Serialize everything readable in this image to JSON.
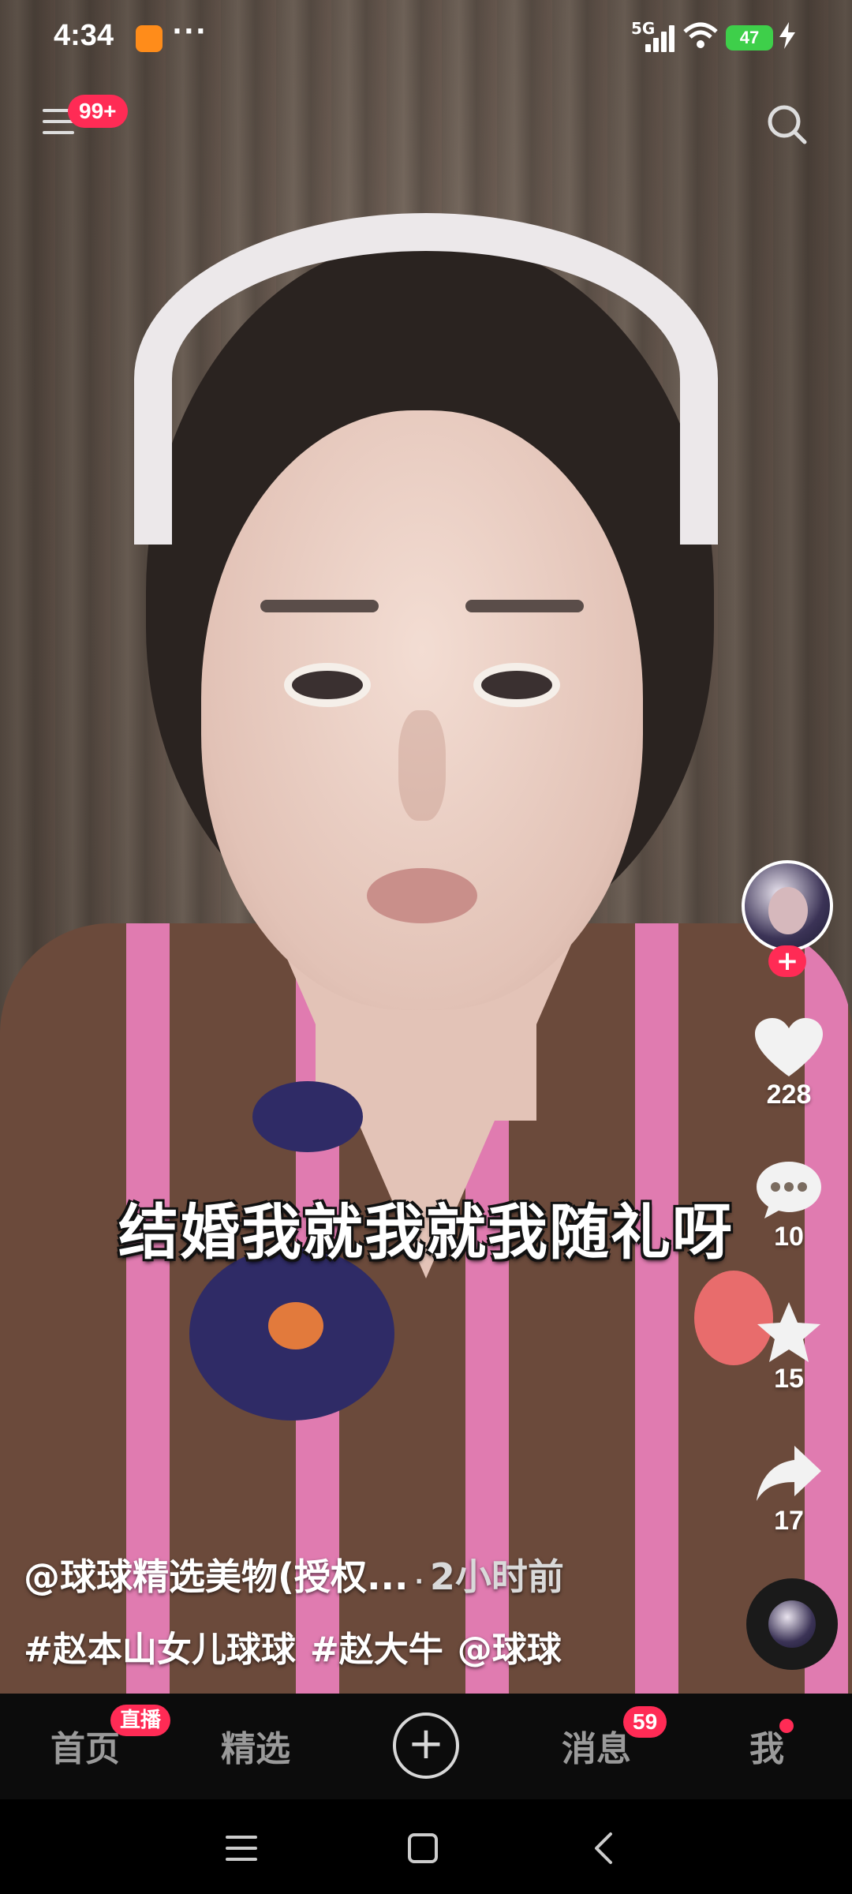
{
  "status_bar": {
    "time": "4:34",
    "network": "5G",
    "battery": "47",
    "more_dots": "···"
  },
  "top": {
    "notification_badge": "99+"
  },
  "subtitle": "结婚我就我就我随礼呀",
  "actions": {
    "likes": "228",
    "comments": "10",
    "favorites": "15",
    "shares": "17",
    "follow_symbol": "+"
  },
  "caption": {
    "author": "@球球精选美物(授权...",
    "separator": "·",
    "time_ago": "2小时前",
    "tags": [
      "#赵本山女儿球球",
      "#赵大牛",
      "@球球"
    ]
  },
  "bottom_nav": {
    "home": "首页",
    "live_badge": "直播",
    "featured": "精选",
    "add": "+",
    "messages": "消息",
    "messages_badge": "59",
    "me": "我"
  },
  "colors": {
    "accent": "#ff2b55",
    "battery": "#3ecf4a"
  }
}
